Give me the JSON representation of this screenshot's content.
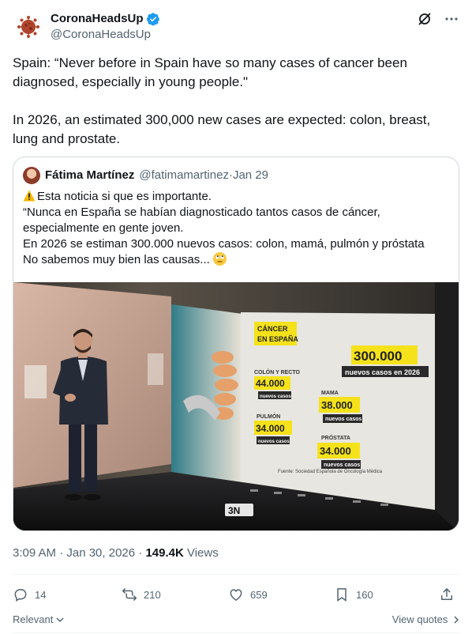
{
  "tweet": {
    "author_name": "CoronaHeadsUp",
    "author_handle": "@CoronaHeadsUp",
    "text_p1": "Spain: “Never before in Spain have so many cases of cancer been diagnosed, especially in young people.\"",
    "text_p2": "In 2026, an estimated 300,000 new cases are expected: colon, breast, lung and prostate.",
    "time": "3:09 AM · Jan 30, 2026 · ",
    "views_count": "149.4K",
    "views_label": " Views"
  },
  "quote": {
    "author_name": "Fátima Martínez",
    "author_handle": "@fatimamartinez",
    "separator": " · ",
    "date": "Jan 29",
    "line1": "Esta noticia si que es importante.",
    "line2": "“Nunca en España se habían diagnosticado tantos casos de cáncer,",
    "line3": "especialmente en gente joven.",
    "line4": "En 2026 se estiman 300.000 nuevos casos: colon, mamá, pulmón y próstata",
    "line5": "No sabemos muy bien las causas..."
  },
  "media": {
    "title": "CÁNCER EN ESPAÑA",
    "total_value": "300.000",
    "total_label": "nuevos casos en 2026",
    "items": [
      {
        "name": "COLÓN Y RECTO",
        "value": "44.000",
        "label": "nuevos casos"
      },
      {
        "name": "MAMA",
        "value": "38.000",
        "label": "nuevos casos"
      },
      {
        "name": "PULMÓN",
        "value": "34.000",
        "label": "nuevos casos"
      },
      {
        "name": "PRÓSTATA",
        "value": "34.000",
        "label": "nuevos casos"
      }
    ],
    "source": "Fuente: Sociedad Española de Oncología Médica",
    "channel_logo": "3N"
  },
  "actions": {
    "replies": "14",
    "reposts": "210",
    "likes": "659",
    "bookmarks": "160"
  },
  "footer": {
    "relevant": "Relevant",
    "view_quotes": "View quotes"
  },
  "colors": {
    "accent": "#1d9bf0",
    "muted": "#536471",
    "yellow_label": "#f5e21b"
  }
}
